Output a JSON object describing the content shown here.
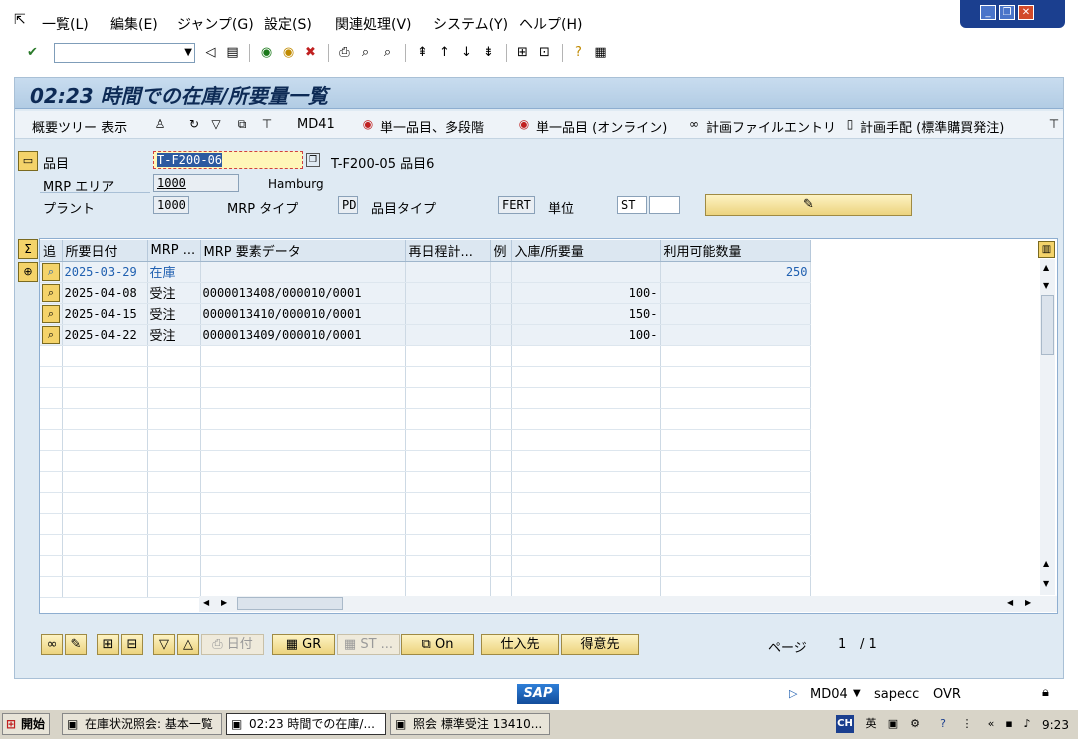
{
  "menu": {
    "items": [
      "一覧(L)",
      "編集(E)",
      "ジャンプ(G)",
      "設定(S)",
      "関連処理(V)",
      "システム(Y)",
      "ヘルプ(H)"
    ]
  },
  "page_title": "02:23 時間での在庫/所要量一覧",
  "app_toolbar": {
    "overview_tree": "概要ツリー 表示",
    "md41": "MD41",
    "single_multi": "単一品目、多段階",
    "single_online": "単一品目 (オンライン)",
    "plan_file": "計画ファイルエントリ",
    "plan_order": "計画手配 (標準購買発注)"
  },
  "header": {
    "material_label": "品目",
    "material_value": "T-F200-06",
    "material_desc": "T-F200-05 品目6",
    "mrp_area_label": "MRP エリア",
    "mrp_area_value": "1000",
    "mrp_area_desc": "Hamburg",
    "plant_label": "プラント",
    "plant_value": "1000",
    "mrp_type_label": "MRP タイプ",
    "mrp_type_value": "PD",
    "material_type_label": "品目タイプ",
    "material_type_value": "FERT",
    "unit_label": "単位",
    "unit_value": "ST"
  },
  "grid": {
    "columns": [
      "追",
      "所要日付",
      "MRP ...",
      "MRP 要素データ",
      "再日程計...",
      "例",
      "入庫/所要量",
      "利用可能数量"
    ],
    "rows": [
      {
        "date": "2025-03-29",
        "mrp": "在庫",
        "data": "",
        "receipt": "",
        "available": "250"
      },
      {
        "date": "2025-04-08",
        "mrp": "受注",
        "data": "0000013408/000010/0001",
        "receipt": "100-",
        "available": ""
      },
      {
        "date": "2025-04-15",
        "mrp": "受注",
        "data": "0000013410/000010/0001",
        "receipt": "150-",
        "available": ""
      },
      {
        "date": "2025-04-22",
        "mrp": "受注",
        "data": "0000013409/000010/0001",
        "receipt": "100-",
        "available": ""
      }
    ]
  },
  "bottom_buttons": {
    "date": "日付",
    "gr": "GR",
    "st": "ST ...",
    "on": "On",
    "vendor": "仕入先",
    "customer": "得意先",
    "page_label": "ページ",
    "page_current": "1",
    "page_total": "/ 1"
  },
  "status": {
    "transaction": "MD04",
    "server": "sapecc",
    "mode": "OVR"
  },
  "taskbar": {
    "start": "開始",
    "tasks": [
      "在庫状況照会: 基本一覧",
      "02:23 時間での在庫/...",
      "照会 標準受注 13410..."
    ],
    "clock": "9:23",
    "lang": "CH"
  },
  "colors": {
    "title": "#0d2a55",
    "frame": "#dfeaf3",
    "button": "#ecd37e"
  }
}
